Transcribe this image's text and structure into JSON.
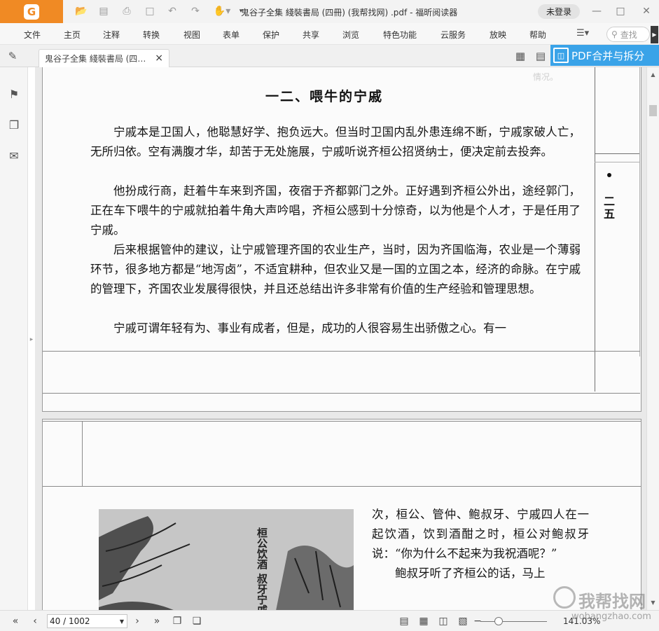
{
  "app": {
    "logo_glyph": "G",
    "doc_title": "鬼谷子全集 綫裝書局 (四冊) (我帮找网) .pdf - 福昕阅读器",
    "login_label": "未登录",
    "accent_color": "#f08a24"
  },
  "quick_access": [
    "open-icon",
    "save-icon",
    "print-icon",
    "new-icon",
    "undo-icon",
    "redo-icon",
    "hand-icon"
  ],
  "menu": {
    "items": [
      "文件",
      "主页",
      "注释",
      "转换",
      "视图",
      "表单",
      "保护",
      "共享",
      "浏览",
      "特色功能",
      "云服务",
      "放映",
      "帮助"
    ],
    "search_placeholder": "查找"
  },
  "tab": {
    "label": "鬼谷子全集 綫裝書局 (四冊) (我帮找网) .pdf",
    "close_glyph": "×"
  },
  "promo": {
    "label": "PDF合并与拆分",
    "color": "#3aa3e8"
  },
  "page1": {
    "chapter_title": "一二、喂牛的宁戚",
    "paragraphs": [
      "宁戚本是卫国人，他聪慧好学、抱负远大。但当时卫国内乱外患连绵不断，宁戚家破人亡，无所归依。空有满腹才华，却苦于无处施展，宁戚听说齐桓公招贤纳士，便决定前去投奔。",
      "他扮成行商，赶着牛车来到齐国，夜宿于齐都郭门之外。正好遇到齐桓公外出，途经郭门，正在车下喂牛的宁戚就拍着牛角大声吟唱，齐桓公感到十分惊奇，以为他是个人才，于是任用了宁戚。",
      "后来根据管仲的建议，让宁戚管理齐国的农业生产，当时，因为齐国临海，农业是一个薄弱环节，很多地方都是“地泻卤”，不适宜耕种，但农业又是一国的立国之本，经济的命脉。在宁戚的管理下，齐国农业发展得很快，并且还总结出许多非常有价值的生产经验和管理思想。",
      "宁戚可谓年轻有为、事业有成者，但是，成功的人很容易生出骄傲之心。有一"
    ],
    "margin_text": "二五"
  },
  "page2": {
    "illustration_caption": "桓公饮酒 叔牙宁戚",
    "text": [
      "次，桓公、管仲、鲍叔牙、宁戚四人在一起饮酒，饮到酒酣之时，桓公对鲍叔牙说：“你为什么不起来为我祝酒呢？”",
      "鲍叔牙听了齐桓公的话，马上"
    ]
  },
  "status": {
    "page_value": "40 / 1002",
    "zoom_text": "141.03%"
  },
  "watermark": {
    "text": "我帮找网",
    "url": "wobangzhao.com"
  }
}
